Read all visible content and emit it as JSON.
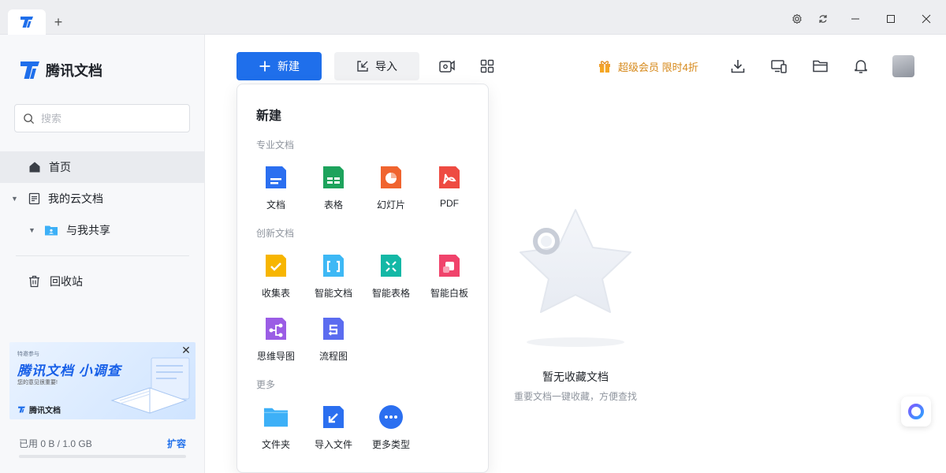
{
  "titlebar": {
    "new_tab_glyph": "+"
  },
  "sidebar": {
    "brand": "腾讯文档",
    "search_placeholder": "搜索",
    "items": [
      {
        "label": "首页",
        "icon": "home-icon"
      },
      {
        "label": "我的云文档",
        "icon": "document-icon"
      },
      {
        "label": "与我共享",
        "icon": "shared-folder-icon"
      },
      {
        "label": "回收站",
        "icon": "trash-icon"
      }
    ],
    "banner": {
      "tiny": "特邀参与",
      "title": "腾讯文档 小调查",
      "subtitle": "您的意见很重要!",
      "footer": "腾讯文档"
    },
    "storage": {
      "used": "已用 0 B / 1.0 GB",
      "expand": "扩容"
    }
  },
  "toolbar": {
    "new_label": "新建",
    "import_label": "导入",
    "vip_label": "超级会员 限时4折"
  },
  "dropdown": {
    "title": "新建",
    "sections": [
      {
        "title": "专业文档",
        "items": [
          {
            "label": "文档",
            "icon": "doc-icon",
            "color": "#2b6ff0"
          },
          {
            "label": "表格",
            "icon": "sheet-icon",
            "color": "#1da35c"
          },
          {
            "label": "幻灯片",
            "icon": "slides-icon",
            "color": "#f0642f"
          },
          {
            "label": "PDF",
            "icon": "pdf-icon",
            "color": "#ee4b42"
          }
        ]
      },
      {
        "title": "创新文档",
        "items": [
          {
            "label": "收集表",
            "icon": "form-icon",
            "color": "#f7b500"
          },
          {
            "label": "智能文档",
            "icon": "smart-doc-icon",
            "color": "#3db8f5"
          },
          {
            "label": "智能表格",
            "icon": "smart-sheet-icon",
            "color": "#14b8a6"
          },
          {
            "label": "智能白板",
            "icon": "whiteboard-icon",
            "color": "#f0436b"
          },
          {
            "label": "思维导图",
            "icon": "mindmap-icon",
            "color": "#9b5de5"
          },
          {
            "label": "流程图",
            "icon": "flowchart-icon",
            "color": "#5b6cf0"
          }
        ]
      },
      {
        "title": "更多",
        "items": [
          {
            "label": "文件夹",
            "icon": "folder-icon",
            "color": "#3db0f7"
          },
          {
            "label": "导入文件",
            "icon": "import-file-icon",
            "color": "#2b6ff0"
          },
          {
            "label": "更多类型",
            "icon": "more-types-icon",
            "color": "#2b6ff0"
          }
        ]
      }
    ]
  },
  "empty": {
    "title": "暂无收藏文档",
    "subtitle": "重要文档一键收藏，方便查找"
  },
  "colors": {
    "accent": "#1f6feb",
    "vip": "#d6891b"
  }
}
